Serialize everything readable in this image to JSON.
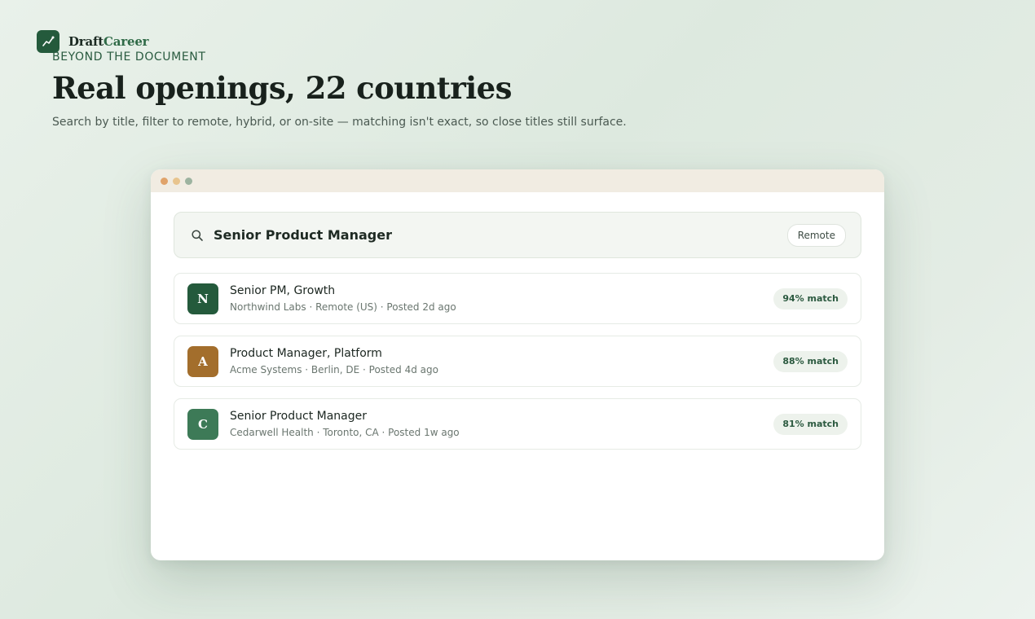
{
  "brand": {
    "name_part1": "Draft",
    "name_part2": "Career",
    "logo_icon": "trending-chart-icon",
    "logo_color": "#245a3c"
  },
  "hero": {
    "eyebrow": "BEYOND THE DOCUMENT",
    "title": "Real openings, 22 countries",
    "subtitle": "Search by title, filter to remote, hybrid, or on-site — matching isn't exact, so close titles still surface."
  },
  "search": {
    "icon": "search-icon",
    "query": "Senior Product Manager",
    "filter": "Remote"
  },
  "results": [
    {
      "initial": "N",
      "avatar_color": "#245a3c",
      "title": "Senior PM, Growth",
      "meta": "Northwind Labs · Remote (US) · Posted 2d ago",
      "match": "94% match"
    },
    {
      "initial": "A",
      "avatar_color": "#a36e2c",
      "title": "Product Manager, Platform",
      "meta": "Acme Systems · Berlin, DE · Posted 4d ago",
      "match": "88% match"
    },
    {
      "initial": "C",
      "avatar_color": "#3d7a57",
      "title": "Senior Product Manager",
      "meta": "Cedarwell Health · Toronto, CA · Posted 1w ago",
      "match": "81% match"
    }
  ]
}
